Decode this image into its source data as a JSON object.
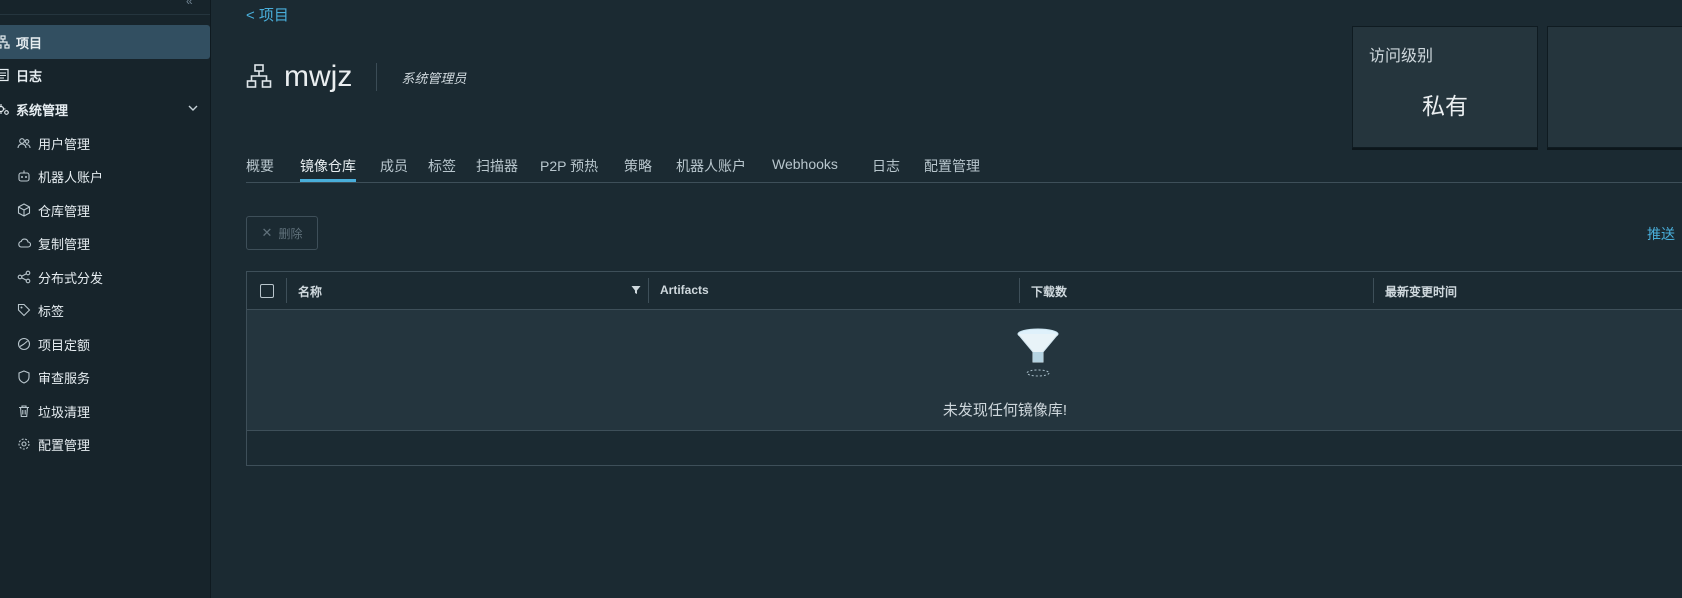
{
  "sidebar": {
    "items": [
      {
        "label": "项目",
        "icon": "project-icon",
        "active": true
      },
      {
        "label": "日志",
        "icon": "log-icon"
      },
      {
        "label": "系统管理",
        "icon": "system-admin-icon"
      }
    ],
    "sub_items": [
      {
        "label": "用户管理",
        "icon": "users-icon"
      },
      {
        "label": "机器人账户",
        "icon": "robot-icon"
      },
      {
        "label": "仓库管理",
        "icon": "registry-icon"
      },
      {
        "label": "复制管理",
        "icon": "cloud-replication-icon"
      },
      {
        "label": "分布式分发",
        "icon": "share-icon"
      },
      {
        "label": "标签",
        "icon": "tag-icon"
      },
      {
        "label": "项目定额",
        "icon": "quota-icon"
      },
      {
        "label": "审查服务",
        "icon": "shield-icon"
      },
      {
        "label": "垃圾清理",
        "icon": "trash-icon"
      },
      {
        "label": "配置管理",
        "icon": "gear-icon"
      }
    ]
  },
  "header": {
    "back_label": "<  项目",
    "project_name": "mwjz",
    "role": "系统管理员"
  },
  "cards": {
    "access_level_label": "访问级别",
    "access_level_value": "私有"
  },
  "tabs": [
    "概要",
    "镜像仓库",
    "成员",
    "标签",
    "扫描器",
    "P2P 预热",
    "策略",
    "机器人账户",
    "Webhooks",
    "日志",
    "配置管理"
  ],
  "active_tab": "镜像仓库",
  "toolbar": {
    "delete_label": "删除",
    "push_label": "推送"
  },
  "grid": {
    "columns": [
      "名称",
      "Artifacts",
      "下载数",
      "最新变更时间"
    ],
    "empty_message": "未发现任何镜像库!"
  },
  "colors": {
    "background": "#1b2a32",
    "sidebar": "#17242b",
    "accent": "#49aeda",
    "active_nav": "#324f61"
  }
}
